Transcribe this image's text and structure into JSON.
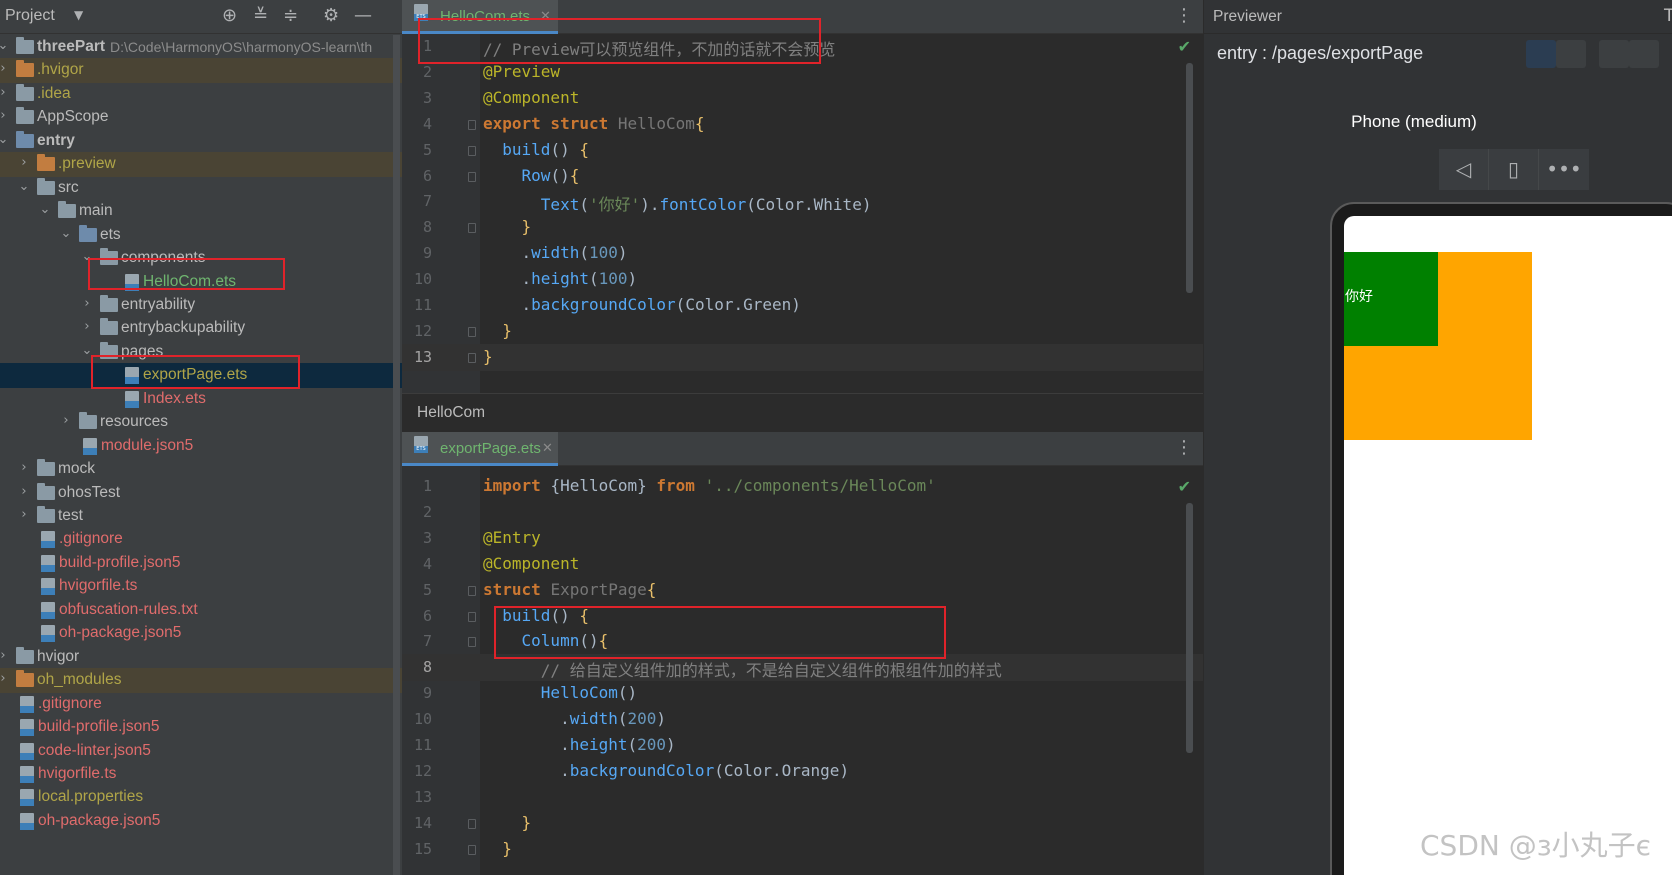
{
  "project": {
    "title": "Project",
    "dropdown": "▼",
    "icons": [
      "target-icon",
      "expand-all-icon",
      "collapse-all-icon",
      "gear-icon",
      "minimize-icon"
    ]
  },
  "tree": [
    {
      "label": "threePart",
      "path": "D:\\Code\\HarmonyOS\\harmonyOS-learn\\th",
      "indent": 0,
      "arrow": "⌄",
      "icon": "folder",
      "color": "default",
      "bold": true
    },
    {
      "label": ".hvigor",
      "indent": 0,
      "arrow": "›",
      "icon": "folder-orange",
      "color": "olive",
      "hl": true
    },
    {
      "label": ".idea",
      "indent": 0,
      "arrow": "›",
      "icon": "folder",
      "color": "olive"
    },
    {
      "label": "AppScope",
      "indent": 0,
      "arrow": "›",
      "icon": "folder",
      "color": "default"
    },
    {
      "label": "entry",
      "indent": 0,
      "arrow": "⌄",
      "icon": "folder-blue",
      "color": "default",
      "bold": true
    },
    {
      "label": ".preview",
      "indent": 1,
      "arrow": "›",
      "icon": "folder-orange",
      "color": "olive",
      "hl": true
    },
    {
      "label": "src",
      "indent": 1,
      "arrow": "⌄",
      "icon": "folder",
      "color": "default"
    },
    {
      "label": "main",
      "indent": 2,
      "arrow": "⌄",
      "icon": "folder",
      "color": "default"
    },
    {
      "label": "ets",
      "indent": 3,
      "arrow": "⌄",
      "icon": "folder-blue",
      "color": "default"
    },
    {
      "label": "components",
      "indent": 4,
      "arrow": "⌄",
      "icon": "folder",
      "color": "default"
    },
    {
      "label": "HelloCom.ets",
      "indent": 5,
      "arrow": "",
      "icon": "file",
      "color": "green"
    },
    {
      "label": "entryability",
      "indent": 4,
      "arrow": "›",
      "icon": "folder",
      "color": "default"
    },
    {
      "label": "entrybackupability",
      "indent": 4,
      "arrow": "›",
      "icon": "folder",
      "color": "default"
    },
    {
      "label": "pages",
      "indent": 4,
      "arrow": "⌄",
      "icon": "folder",
      "color": "default"
    },
    {
      "label": "exportPage.ets",
      "indent": 5,
      "arrow": "",
      "icon": "file",
      "color": "olive",
      "sel": true
    },
    {
      "label": "Index.ets",
      "indent": 5,
      "arrow": "",
      "icon": "file",
      "color": "red"
    },
    {
      "label": "resources",
      "indent": 3,
      "arrow": "›",
      "icon": "folder",
      "color": "default"
    },
    {
      "label": "module.json5",
      "indent": 3,
      "arrow": "",
      "icon": "file",
      "color": "red"
    },
    {
      "label": "mock",
      "indent": 1,
      "arrow": "›",
      "icon": "folder",
      "color": "default"
    },
    {
      "label": "ohosTest",
      "indent": 1,
      "arrow": "›",
      "icon": "folder",
      "color": "default"
    },
    {
      "label": "test",
      "indent": 1,
      "arrow": "›",
      "icon": "folder",
      "color": "default"
    },
    {
      "label": ".gitignore",
      "indent": 1,
      "arrow": "",
      "icon": "file",
      "color": "red"
    },
    {
      "label": "build-profile.json5",
      "indent": 1,
      "arrow": "",
      "icon": "file",
      "color": "red"
    },
    {
      "label": "hvigorfile.ts",
      "indent": 1,
      "arrow": "",
      "icon": "file",
      "color": "red"
    },
    {
      "label": "obfuscation-rules.txt",
      "indent": 1,
      "arrow": "",
      "icon": "file",
      "color": "red"
    },
    {
      "label": "oh-package.json5",
      "indent": 1,
      "arrow": "",
      "icon": "file",
      "color": "red"
    },
    {
      "label": "hvigor",
      "indent": 0,
      "arrow": "›",
      "icon": "folder",
      "color": "default"
    },
    {
      "label": "oh_modules",
      "indent": 0,
      "arrow": "›",
      "icon": "folder-orange",
      "color": "olive",
      "hl": true
    },
    {
      "label": ".gitignore",
      "indent": 0,
      "arrow": "",
      "icon": "file",
      "color": "red"
    },
    {
      "label": "build-profile.json5",
      "indent": 0,
      "arrow": "",
      "icon": "file",
      "color": "red"
    },
    {
      "label": "code-linter.json5",
      "indent": 0,
      "arrow": "",
      "icon": "file",
      "color": "red"
    },
    {
      "label": "hvigorfile.ts",
      "indent": 0,
      "arrow": "",
      "icon": "file",
      "color": "red"
    },
    {
      "label": "local.properties",
      "indent": 0,
      "arrow": "",
      "icon": "file",
      "color": "olive"
    },
    {
      "label": "oh-package.json5",
      "indent": 0,
      "arrow": "",
      "icon": "file",
      "color": "red"
    }
  ],
  "editor_top": {
    "tab_label": "HelloCom.ets",
    "tab_close": "✕",
    "kebab": "⋮",
    "check": "✔",
    "current_line": 13,
    "lines": [
      [
        [
          "cmt",
          "// Preview可以预览组件，不加的话就不会预览"
        ]
      ],
      [
        [
          "ann",
          "@Preview"
        ]
      ],
      [
        [
          "ann",
          "@Component"
        ]
      ],
      [
        [
          "kw",
          "export struct "
        ],
        [
          "cls",
          "HelloCom"
        ],
        [
          "brace",
          "{"
        ]
      ],
      [
        [
          "txt",
          "  "
        ],
        [
          "meth",
          "build"
        ],
        [
          "paren",
          "() "
        ],
        [
          "brace",
          "{"
        ]
      ],
      [
        [
          "txt",
          "    "
        ],
        [
          "meth",
          "Row"
        ],
        [
          "paren",
          "()"
        ],
        [
          "brace",
          "{"
        ]
      ],
      [
        [
          "txt",
          "      "
        ],
        [
          "meth",
          "Text"
        ],
        [
          "paren",
          "("
        ],
        [
          "str",
          "'你好'"
        ],
        [
          "paren",
          ")."
        ],
        [
          "meth",
          "fontColor"
        ],
        [
          "paren",
          "("
        ],
        [
          "txt",
          "Color.White"
        ],
        [
          "paren",
          ")"
        ]
      ],
      [
        [
          "txt",
          "    "
        ],
        [
          "brace",
          "}"
        ]
      ],
      [
        [
          "txt",
          "    ."
        ],
        [
          "meth",
          "width"
        ],
        [
          "paren",
          "("
        ],
        [
          "num",
          "100"
        ],
        [
          "paren",
          ")"
        ]
      ],
      [
        [
          "txt",
          "    ."
        ],
        [
          "meth",
          "height"
        ],
        [
          "paren",
          "("
        ],
        [
          "num",
          "100"
        ],
        [
          "paren",
          ")"
        ]
      ],
      [
        [
          "txt",
          "    ."
        ],
        [
          "meth",
          "backgroundColor"
        ],
        [
          "paren",
          "("
        ],
        [
          "txt",
          "Color.Green"
        ],
        [
          "paren",
          ")"
        ]
      ],
      [
        [
          "txt",
          "  "
        ],
        [
          "brace",
          "}"
        ]
      ],
      [
        [
          "brace",
          "}"
        ]
      ]
    ]
  },
  "breadcrumb": "HelloCom",
  "editor_bottom": {
    "tab_label": "exportPage.ets",
    "tab_close": "✕",
    "kebab": "⋮",
    "check": "✔",
    "current_line": 8,
    "lines": [
      [
        [
          "kw",
          "import "
        ],
        [
          "txt",
          "{HelloCom} "
        ],
        [
          "kw",
          "from "
        ],
        [
          "str",
          "'../components/HelloCom'"
        ]
      ],
      [
        [
          "txt",
          ""
        ]
      ],
      [
        [
          "ann",
          "@Entry"
        ]
      ],
      [
        [
          "ann",
          "@Component"
        ]
      ],
      [
        [
          "kw",
          "struct "
        ],
        [
          "cls",
          "ExportPage"
        ],
        [
          "brace",
          "{"
        ]
      ],
      [
        [
          "txt",
          "  "
        ],
        [
          "meth",
          "build"
        ],
        [
          "paren",
          "() "
        ],
        [
          "brace",
          "{"
        ]
      ],
      [
        [
          "txt",
          "    "
        ],
        [
          "meth",
          "Column"
        ],
        [
          "paren",
          "()"
        ],
        [
          "brace",
          "{"
        ]
      ],
      [
        [
          "txt",
          "      "
        ],
        [
          "cmt",
          "// 给自定义组件加的样式，不是给自定义组件的根组件加的样式"
        ]
      ],
      [
        [
          "txt",
          "      "
        ],
        [
          "meth",
          "HelloCom"
        ],
        [
          "paren",
          "()"
        ]
      ],
      [
        [
          "txt",
          "        ."
        ],
        [
          "meth",
          "width"
        ],
        [
          "paren",
          "("
        ],
        [
          "num",
          "200"
        ],
        [
          "paren",
          ")"
        ]
      ],
      [
        [
          "txt",
          "        ."
        ],
        [
          "meth",
          "height"
        ],
        [
          "paren",
          "("
        ],
        [
          "num",
          "200"
        ],
        [
          "paren",
          ")"
        ]
      ],
      [
        [
          "txt",
          "        ."
        ],
        [
          "meth",
          "backgroundColor"
        ],
        [
          "paren",
          "("
        ],
        [
          "txt",
          "Color.Orange"
        ],
        [
          "paren",
          ")"
        ]
      ],
      [
        [
          "txt",
          ""
        ]
      ],
      [
        [
          "txt",
          "    "
        ],
        [
          "brace",
          "}"
        ]
      ],
      [
        [
          "txt",
          "  "
        ],
        [
          "brace",
          "}"
        ]
      ]
    ]
  },
  "previewer": {
    "title": "Previewer",
    "edge_glyph": "T",
    "route": "entry : /pages/exportPage",
    "device_name": "Phone (medium)",
    "tools": [
      "◁",
      "▯",
      "•••"
    ],
    "preview_text": "你好",
    "watermark": "CSDN @з小丸子є",
    "colors": {
      "green": "#008000",
      "orange": "#ffa500"
    }
  }
}
